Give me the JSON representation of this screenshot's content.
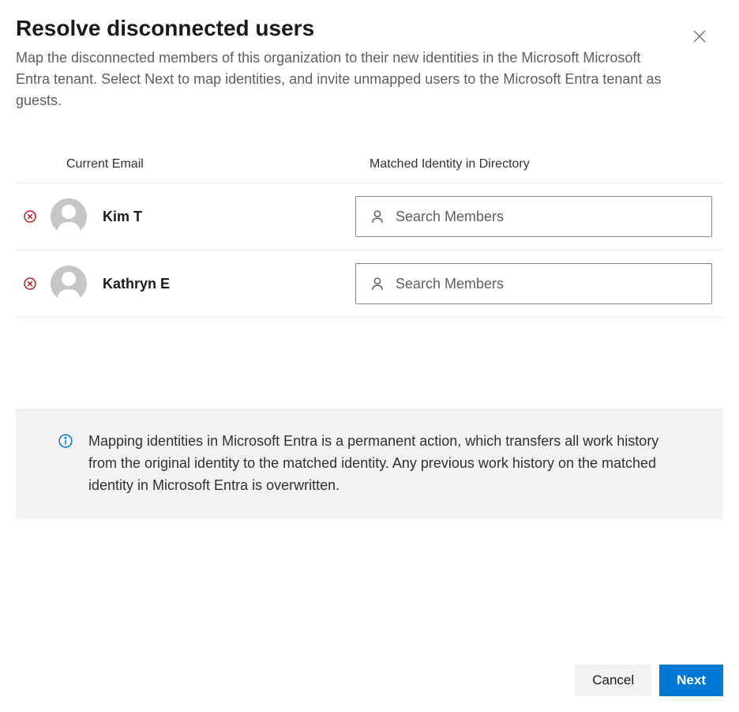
{
  "header": {
    "title": "Resolve disconnected users",
    "subtitle": "Map the disconnected members of this organization to their new identities in the Microsoft Microsoft Entra tenant. Select Next to map identities, and invite unmapped users to the Microsoft Entra tenant as guests."
  },
  "columns": {
    "current_email": "Current Email",
    "matched_identity": "Matched Identity in Directory"
  },
  "users": [
    {
      "name": "Kim T",
      "search_placeholder": "Search Members"
    },
    {
      "name": "Kathryn E",
      "search_placeholder": "Search Members"
    }
  ],
  "info": {
    "text": "Mapping identities in Microsoft Entra is a permanent action, which transfers all work history from the original identity to the matched identity. Any previous work history on the matched identity in Microsoft Entra is overwritten."
  },
  "footer": {
    "cancel": "Cancel",
    "next": "Next"
  }
}
